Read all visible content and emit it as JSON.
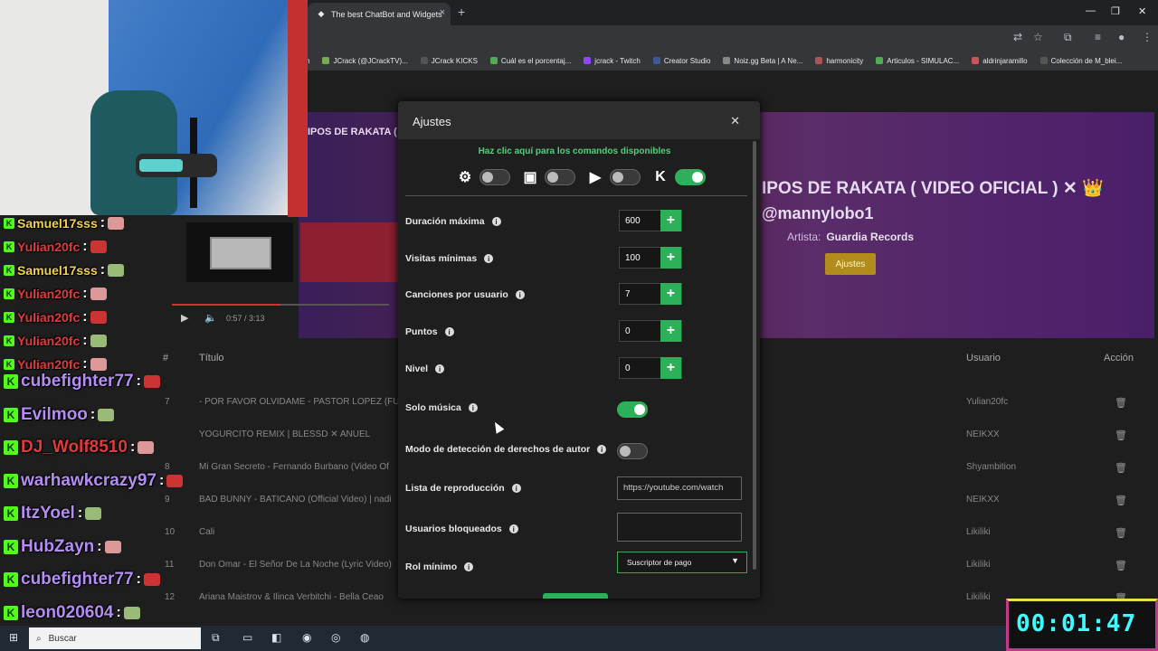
{
  "browser": {
    "tab_title": "The best ChatBot and Widgets",
    "bookmarks": [
      "ch",
      "JCrack (@JCrackTV)...",
      "JCrack KICKS",
      "Cuál es el porcentaj...",
      "jcrack - Twitch",
      "Creator Studio",
      "Noiz.gg Beta | A Ne...",
      "harmonicity",
      "Articulos - SIMULAC...",
      "aldrinjaramillo",
      "Colección de M_blei..."
    ]
  },
  "hero": {
    "title": "IPOS DE RAKATA ( VIDEO OFICIAL ) ✕ 👑",
    "title_left": "IPOS DE RAKATA ( V",
    "user": "@mannylobo1",
    "artist_label": "Artista:",
    "artist_value": "Guardia Records",
    "button": "Ajustes"
  },
  "player": {
    "time": "0:57 / 3:13"
  },
  "table": {
    "headers": {
      "num": "#",
      "title": "Título",
      "user": "Usuario",
      "action": "Acción"
    },
    "rows": [
      {
        "num": "7",
        "title": "- POR FAVOR OLVIDAME - PASTOR LOPEZ (FUL",
        "user": "Yulian20fc"
      },
      {
        "num": "",
        "title": "YOGURCITO REMIX | BLESSD ✕ ANUEL",
        "user": "NEIKXX"
      },
      {
        "num": "8",
        "title": "Mi Gran Secreto - Fernando Burbano (Video Of",
        "user": "Shyambition"
      },
      {
        "num": "9",
        "title": "BAD BUNNY - BATICANO (Official Video) | nadi",
        "user": "NEIKXX"
      },
      {
        "num": "10",
        "title": "Cali",
        "user": "Likiliki"
      },
      {
        "num": "11",
        "title": "Don Omar - El Señor De La Noche (Lyric Video)",
        "user": "Likiliki"
      },
      {
        "num": "12",
        "title": "Ariana Maistrov & Ilinca Verbitchi - Bella Ceao",
        "user": "Likiliki"
      }
    ]
  },
  "chat": [
    {
      "name": "Samuel17sss",
      "color": "#f2d24a",
      "size": "small"
    },
    {
      "name": "Yulian20fc",
      "color": "#e03a3a",
      "size": "small"
    },
    {
      "name": "Samuel17sss",
      "color": "#f2d24a",
      "size": "small"
    },
    {
      "name": "Yulian20fc",
      "color": "#e03a3a",
      "size": "small"
    },
    {
      "name": "Yulian20fc",
      "color": "#e03a3a",
      "size": "small"
    },
    {
      "name": "Yulian20fc",
      "color": "#e03a3a",
      "size": "small"
    },
    {
      "name": "Yulian20fc",
      "color": "#e03a3a",
      "size": "small"
    },
    {
      "name": "cubefighter77",
      "color": "#b48cf2",
      "size": "big"
    },
    {
      "name": "Evilmoo",
      "color": "#b48cf2",
      "size": "big"
    },
    {
      "name": "DJ_Wolf8510",
      "color": "#e03a3a",
      "size": "big"
    },
    {
      "name": "warhawkcrazy97",
      "color": "#b48cf2",
      "size": "big"
    },
    {
      "name": "ItzYoel",
      "color": "#b48cf2",
      "size": "big"
    },
    {
      "name": "HubZayn",
      "color": "#b48cf2",
      "size": "big"
    },
    {
      "name": "cubefighter77",
      "color": "#b48cf2",
      "size": "big"
    },
    {
      "name": "leon020604",
      "color": "#b48cf2",
      "size": "big"
    }
  ],
  "modal": {
    "title": "Ajustes",
    "commands_link": "Haz clic aquí para los comandos disponibles",
    "platforms": [
      {
        "icon": "kick-bot-icon",
        "enabled": false
      },
      {
        "icon": "twitch-icon",
        "enabled": false
      },
      {
        "icon": "youtube-icon",
        "enabled": false
      },
      {
        "icon": "kick-icon",
        "enabled": true
      }
    ],
    "fields": {
      "max_duration": {
        "label": "Duración máxima",
        "value": "600"
      },
      "min_views": {
        "label": "Visitas mínimas",
        "value": "100"
      },
      "songs_per_user": {
        "label": "Canciones por usuario",
        "value": "7"
      },
      "points": {
        "label": "Puntos",
        "value": "0"
      },
      "level": {
        "label": "Nivel",
        "value": "0"
      },
      "music_only": {
        "label": "Solo música",
        "enabled": true
      },
      "copyright_detection": {
        "label": "Modo de detección de derechos de autor",
        "enabled": false
      },
      "playlist": {
        "label": "Lista de reproducción",
        "value": "https://youtube.com/watch"
      },
      "blocked_users": {
        "label": "Usuarios bloqueados",
        "value": ""
      },
      "min_role": {
        "label": "Rol mínimo",
        "value": "Suscriptor de pago"
      }
    }
  },
  "taskbar": {
    "search_label": "Buscar"
  },
  "timer": {
    "text": "00:01:47"
  },
  "colors": {
    "accent": "#2eb05a",
    "kick": "#53fc18",
    "timer": "#3dfcff"
  }
}
